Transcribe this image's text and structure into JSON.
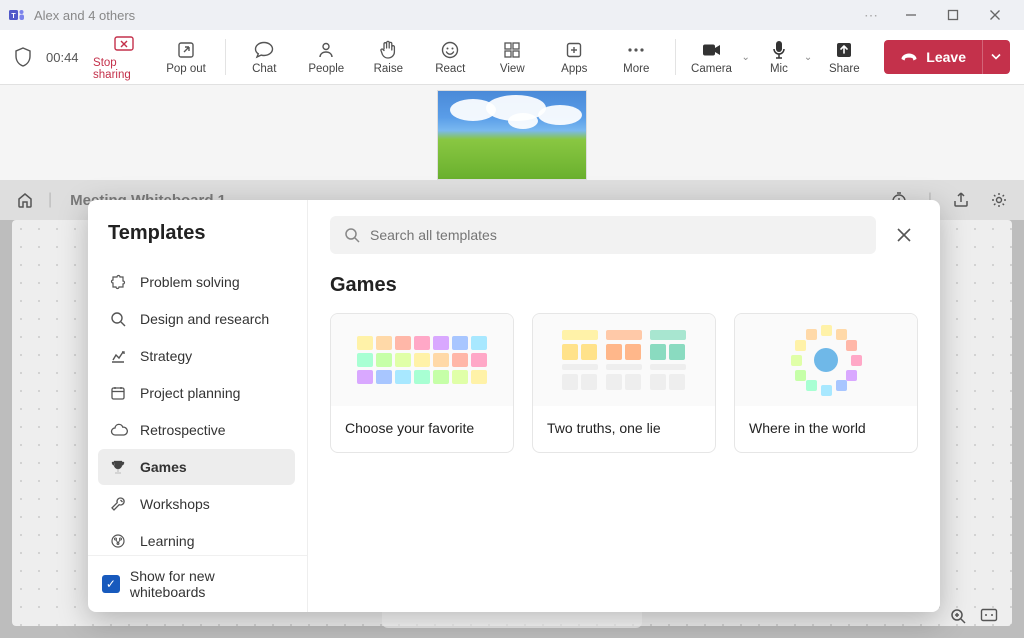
{
  "titlebar": {
    "title": "Alex and 4 others"
  },
  "meetbar": {
    "timer": "00:44",
    "items": {
      "stop_sharing": "Stop sharing",
      "pop_out": "Pop out",
      "chat": "Chat",
      "people": "People",
      "raise": "Raise",
      "react": "React",
      "view": "View",
      "apps": "Apps",
      "more": "More",
      "camera": "Camera",
      "mic": "Mic",
      "share": "Share"
    },
    "leave_label": "Leave"
  },
  "whiteboard": {
    "title": "Meeting Whiteboard 1"
  },
  "templates": {
    "heading": "Templates",
    "search_placeholder": "Search all templates",
    "section_title": "Games",
    "show_new_label": "Show for new whiteboards",
    "categories": [
      {
        "icon": "puzzle",
        "label": "Problem solving"
      },
      {
        "icon": "search",
        "label": "Design and research"
      },
      {
        "icon": "chart",
        "label": "Strategy"
      },
      {
        "icon": "calendar",
        "label": "Project planning"
      },
      {
        "icon": "cloud",
        "label": "Retrospective"
      },
      {
        "icon": "trophy",
        "label": "Games",
        "selected": true
      },
      {
        "icon": "wrench",
        "label": "Workshops"
      },
      {
        "icon": "brain",
        "label": "Learning"
      }
    ],
    "cards": [
      {
        "title": "Choose your favorite",
        "preview": "grid"
      },
      {
        "title": "Two truths, one lie",
        "preview": "cols"
      },
      {
        "title": "Where in the world",
        "preview": "ring"
      }
    ]
  },
  "colors": {
    "danger": "#c4314b",
    "primary": "#185abd"
  }
}
